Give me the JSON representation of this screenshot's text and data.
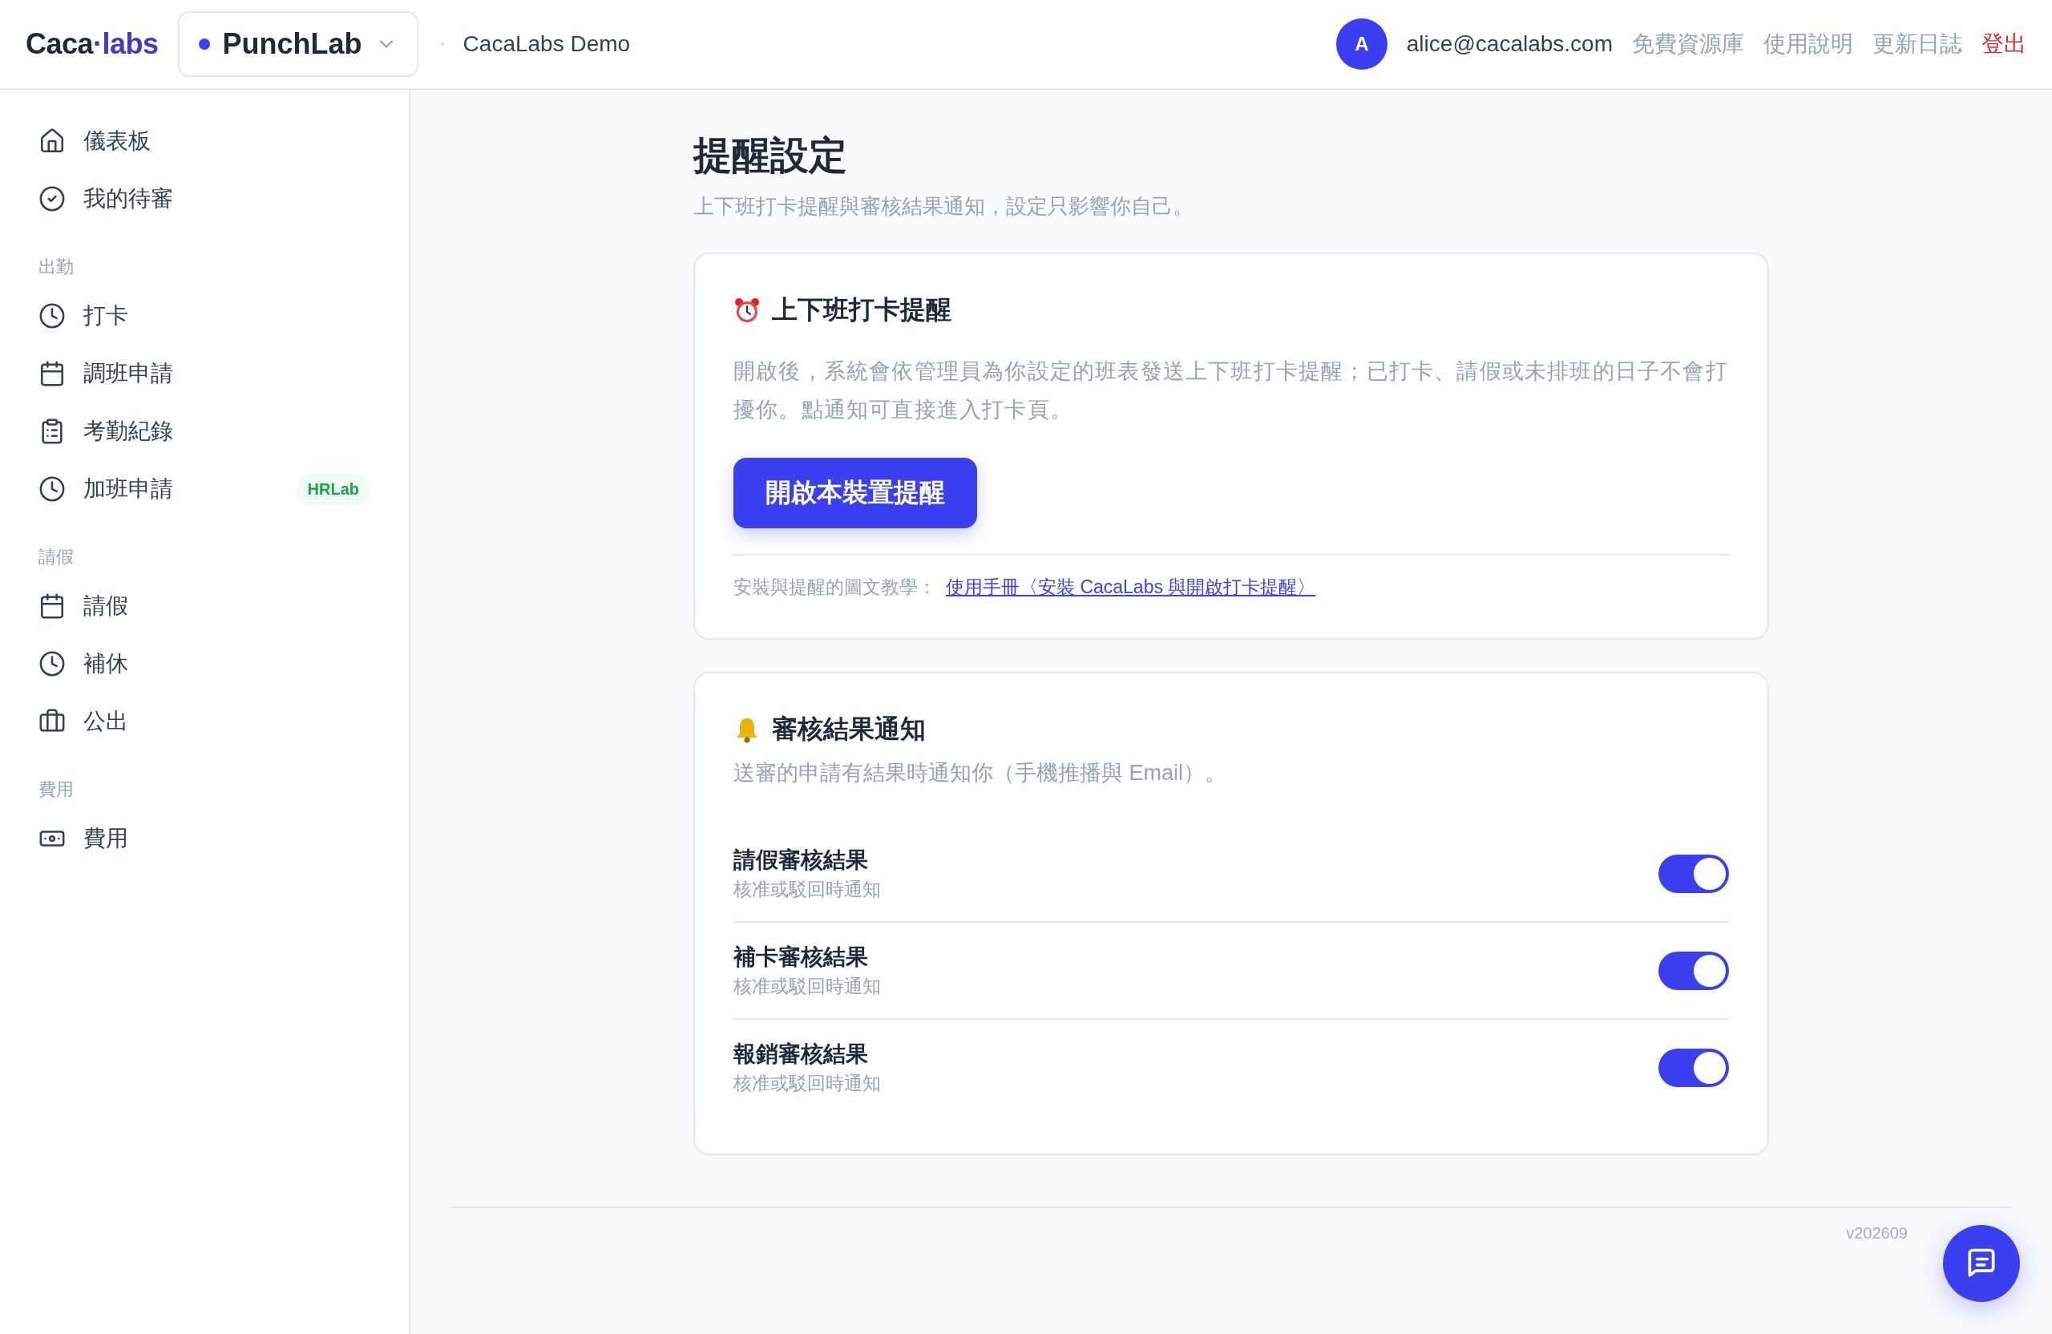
{
  "header": {
    "logo": {
      "main": "Caca",
      "accent": "·labs"
    },
    "project": "PunchLab",
    "org": "CacaLabs Demo",
    "avatar": "A",
    "email": "alice@cacalabs.com",
    "links": [
      "免費資源庫",
      "使用說明",
      "更新日誌"
    ],
    "logout": "登出"
  },
  "sidebar": {
    "groups": [
      {
        "items": [
          {
            "kind": "home",
            "label": "儀表板"
          },
          {
            "kind": "check",
            "label": "我的待審"
          }
        ]
      },
      {
        "title": "出勤",
        "items": [
          {
            "kind": "clock",
            "label": "打卡"
          },
          {
            "kind": "calendar",
            "label": "調班申請"
          },
          {
            "kind": "clipboard",
            "label": "考勤紀錄"
          },
          {
            "kind": "clock",
            "label": "加班申請",
            "badge": "HRLab"
          }
        ]
      },
      {
        "title": "請假",
        "items": [
          {
            "kind": "calendar",
            "label": "請假"
          },
          {
            "kind": "clock",
            "label": "補休"
          },
          {
            "kind": "briefcase",
            "label": "公出"
          }
        ]
      },
      {
        "title": "費用",
        "items": [
          {
            "kind": "money",
            "label": "費用"
          }
        ]
      }
    ]
  },
  "page": {
    "title": "提醒設定",
    "subtitle": "上下班打卡提醒與審核結果通知，設定只影響你自己。"
  },
  "punch_card": {
    "heading": "上下班打卡提醒",
    "description": "開啟後，系統會依管理員為你設定的班表發送上下班打卡提醒；已打卡、請假或未排班的日子不會打擾你。點通知可直接進入打卡頁。",
    "button": "開啟本裝置提醒",
    "tutorial_label": "安裝與提醒的圖文教學：",
    "tutorial_link": "使用手冊〈安裝 CacaLabs 與開啟打卡提醒〉"
  },
  "review_card": {
    "heading": "審核結果通知",
    "description": "送審的申請有結果時通知你（手機推播與 Email）。",
    "rows": [
      {
        "title": "請假審核結果",
        "subtitle": "核准或駁回時通知",
        "on": true
      },
      {
        "title": "補卡審核結果",
        "subtitle": "核准或駁回時通知",
        "on": true
      },
      {
        "title": "報銷審核結果",
        "subtitle": "核准或駁回時通知",
        "on": true
      }
    ]
  },
  "footer": {
    "version": "v202609"
  }
}
